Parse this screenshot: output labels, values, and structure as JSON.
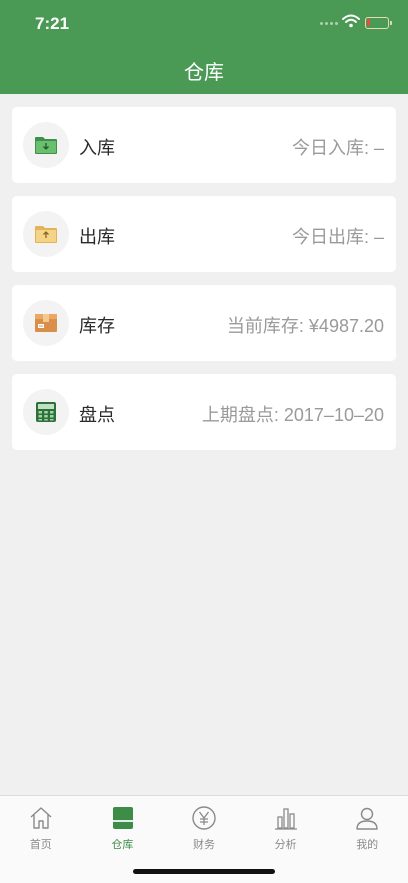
{
  "status_bar": {
    "time": "7:21"
  },
  "nav": {
    "title": "仓库"
  },
  "items": [
    {
      "label": "入库",
      "info": "今日入库: –",
      "icon": "folder-download-icon"
    },
    {
      "label": "出库",
      "info": "今日出库: –",
      "icon": "folder-upload-icon"
    },
    {
      "label": "库存",
      "info": "当前库存: ¥4987.20",
      "icon": "package-box-icon"
    },
    {
      "label": "盘点",
      "info": "上期盘点: 2017–10–20",
      "icon": "calculator-icon"
    }
  ],
  "tabs": [
    {
      "label": "首页",
      "icon": "home-icon"
    },
    {
      "label": "仓库",
      "icon": "warehouse-icon",
      "active": true
    },
    {
      "label": "财务",
      "icon": "yen-icon"
    },
    {
      "label": "分析",
      "icon": "bar-chart-icon"
    },
    {
      "label": "我的",
      "icon": "user-icon"
    }
  ],
  "colors": {
    "brand_green": "#4a9a55",
    "active_tab": "#3d8c48",
    "inactive_tab": "#8a8a8a"
  }
}
